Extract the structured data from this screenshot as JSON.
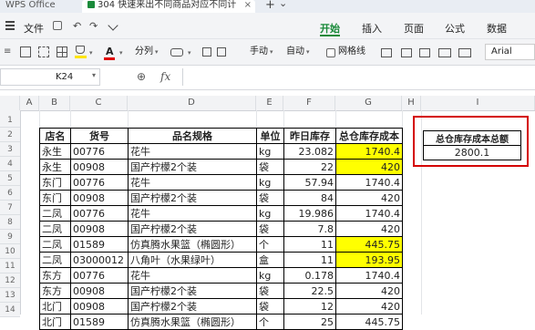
{
  "titlebar": {
    "app_tab": "WPS Office",
    "doc_tab": "304 快速来出不同商品对应不同计",
    "add_label": "+",
    "menu_arrow": "⌄"
  },
  "menubar": {
    "file_label": "文件",
    "tabs": [
      "开始",
      "插入",
      "页面",
      "公式",
      "数据"
    ],
    "active_tab": "开始"
  },
  "toolbar": {
    "paste_label": "≡",
    "font_color_label": "A",
    "split_label": "分列",
    "manual_label": "手动",
    "auto_label": "自动",
    "gridlines_label": "网格线",
    "font_name": "Arial"
  },
  "formulabar": {
    "cell_ref": "K24",
    "fx_label": "fx",
    "zoom_label": "⊕",
    "value": ""
  },
  "columns": [
    "A",
    "B",
    "C",
    "D",
    "E",
    "F",
    "G",
    "H",
    "I"
  ],
  "row_numbers": [
    "1",
    "2",
    "3",
    "4",
    "5",
    "6",
    "7",
    "8",
    "9",
    "10",
    "11",
    "12",
    "13",
    "14"
  ],
  "table": {
    "headers": [
      "店名",
      "货号",
      "品名规格",
      "单位",
      "昨日库存",
      "总仓库存成本"
    ],
    "rows": [
      [
        "永生",
        "00776",
        "花牛",
        "kg",
        "23.082",
        "1740.4"
      ],
      [
        "永生",
        "00908",
        "国产柠檬2个装",
        "袋",
        "22",
        "420"
      ],
      [
        "东门",
        "00776",
        "花牛",
        "kg",
        "57.94",
        "1740.4"
      ],
      [
        "东门",
        "00908",
        "国产柠檬2个装",
        "袋",
        "84",
        "420"
      ],
      [
        "二凤",
        "00776",
        "花牛",
        "kg",
        "19.986",
        "1740.4"
      ],
      [
        "二凤",
        "00908",
        "国产柠檬2个装",
        "袋",
        "7.8",
        "420"
      ],
      [
        "二凤",
        "01589",
        "仿真腾水果篮（椭圆形）",
        "个",
        "11",
        "445.75"
      ],
      [
        "二凤",
        "03000012",
        "八角叶（水果绿叶）",
        "盒",
        "11",
        "193.95"
      ],
      [
        "东方",
        "00776",
        "花牛",
        "kg",
        "0.178",
        "1740.4"
      ],
      [
        "东方",
        "00908",
        "国产柠檬2个装",
        "袋",
        "22.5",
        "420"
      ],
      [
        "北门",
        "00908",
        "国产柠檬2个装",
        "袋",
        "12",
        "420"
      ],
      [
        "北门",
        "01589",
        "仿真腾水果篮（椭圆形）",
        "个",
        "25",
        "445.75"
      ]
    ],
    "highlighted_rows": [
      0,
      1,
      6,
      7
    ]
  },
  "summary": {
    "label": "总仓库存成本总额",
    "value": "2800.1",
    "highlight_color": "#d40000"
  },
  "colors": {
    "accent": "#1a8a3a",
    "highlight": "#ffff00"
  }
}
